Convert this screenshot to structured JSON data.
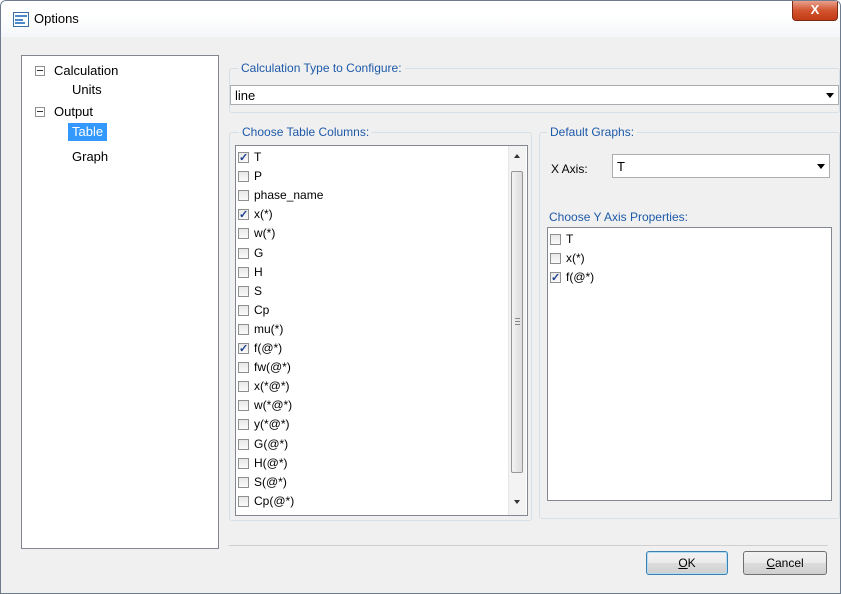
{
  "window": {
    "title": "Options",
    "close_glyph": "X"
  },
  "tree": {
    "items": [
      {
        "label": "Calculation",
        "expanded": true,
        "level": 0
      },
      {
        "label": "Units",
        "level": 1
      },
      {
        "label": "Output",
        "expanded": true,
        "level": 0
      },
      {
        "label": "Table",
        "level": 1,
        "selected": true
      },
      {
        "label": "Graph",
        "level": 1
      }
    ]
  },
  "calc_type": {
    "label": "Calculation Type to Configure:",
    "value": "line"
  },
  "table_columns": {
    "label": "Choose Table Columns:",
    "items": [
      {
        "label": "T",
        "checked": true
      },
      {
        "label": "P",
        "checked": false
      },
      {
        "label": "phase_name",
        "checked": false
      },
      {
        "label": "x(*)",
        "checked": true
      },
      {
        "label": "w(*)",
        "checked": false
      },
      {
        "label": "G",
        "checked": false
      },
      {
        "label": "H",
        "checked": false
      },
      {
        "label": "S",
        "checked": false
      },
      {
        "label": "Cp",
        "checked": false
      },
      {
        "label": "mu(*)",
        "checked": false
      },
      {
        "label": "f(@*)",
        "checked": true
      },
      {
        "label": "fw(@*)",
        "checked": false
      },
      {
        "label": "x(*@*)",
        "checked": false
      },
      {
        "label": "w(*@*)",
        "checked": false
      },
      {
        "label": "y(*@*)",
        "checked": false
      },
      {
        "label": "G(@*)",
        "checked": false
      },
      {
        "label": "H(@*)",
        "checked": false
      },
      {
        "label": "S(@*)",
        "checked": false
      },
      {
        "label": "Cp(@*)",
        "checked": false
      }
    ]
  },
  "default_graphs": {
    "label": "Default Graphs:",
    "x_axis_label": "X Axis:",
    "x_axis_value": "T",
    "y_axis_label": "Choose Y Axis Properties:",
    "y_items": [
      {
        "label": "T",
        "checked": false
      },
      {
        "label": "x(*)",
        "checked": false
      },
      {
        "label": "f(@*)",
        "checked": true
      }
    ]
  },
  "buttons": {
    "ok": {
      "accel": "O",
      "rest": "K"
    },
    "cancel": {
      "accel": "C",
      "rest": "ancel"
    }
  },
  "icons": {
    "window_icon": "options-window-icon",
    "close": "close-icon",
    "expander": "tree-collapse-icon",
    "dropdown": "chevron-down-icon",
    "check": "checkmark-icon"
  },
  "colors": {
    "selection": "#3399ff",
    "group_label": "#1e5aa8",
    "close_button": "#c94a24",
    "dialog_bg": "#f0f0f0"
  }
}
